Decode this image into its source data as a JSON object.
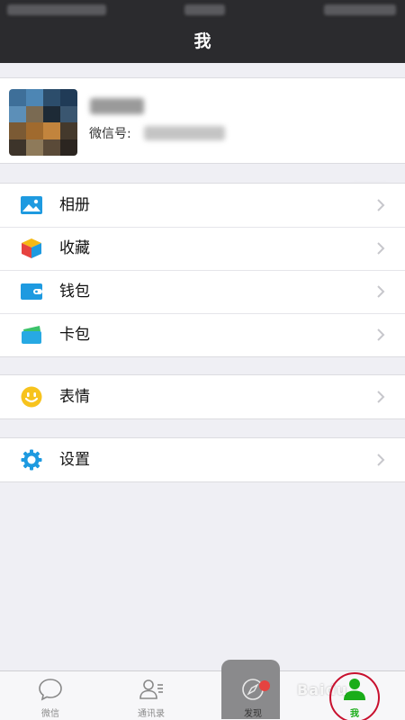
{
  "header": {
    "title": "我"
  },
  "profile": {
    "wechat_id_label": "微信号:"
  },
  "menu_groups": [
    [
      {
        "label": "相册",
        "icon": "photo-icon"
      },
      {
        "label": "收藏",
        "icon": "favorites-cube-icon"
      },
      {
        "label": "钱包",
        "icon": "wallet-icon"
      },
      {
        "label": "卡包",
        "icon": "card-pack-icon"
      }
    ],
    [
      {
        "label": "表情",
        "icon": "smiley-icon"
      }
    ],
    [
      {
        "label": "设置",
        "icon": "gear-icon"
      }
    ]
  ],
  "tabbar": {
    "items": [
      {
        "label": "微信",
        "icon": "chat-bubble-icon"
      },
      {
        "label": "通讯录",
        "icon": "contacts-icon"
      },
      {
        "label": "发现",
        "icon": "compass-icon"
      },
      {
        "label": "我",
        "icon": "person-icon",
        "active": true
      }
    ]
  },
  "watermark": "Baidu",
  "colors": {
    "accent": "#1aad19",
    "nav_bg": "#2b2b2e",
    "badge": "#e64340"
  }
}
